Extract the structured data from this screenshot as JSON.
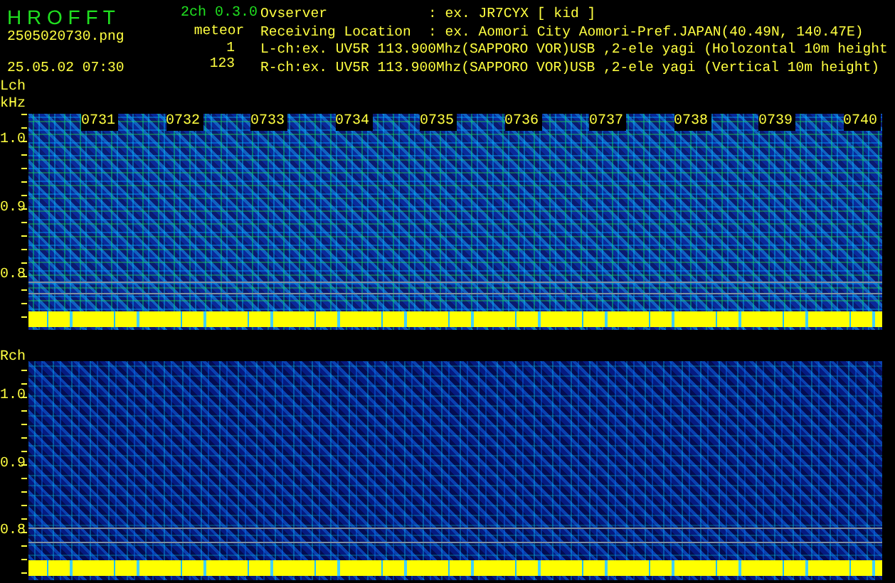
{
  "header": {
    "app_title": "H R O F F T",
    "version": "2ch 0.3.0",
    "filename": "2505020730.png",
    "datetime": "25.05.02 07:30",
    "meteor_label": "meteor",
    "meteor_counts": [
      "1",
      "123"
    ],
    "info_lines": [
      {
        "label": "Ovserver",
        "value": ": ex. JR7CYX [ kid ]"
      },
      {
        "label": "Receiving Location",
        "value": ": ex. Aomori City Aomori-Pref.JAPAN(40.49N, 140.47E)"
      },
      {
        "text": "L-ch:ex. UV5R 113.900Mhz(SAPPORO VOR)USB ,2-ele yagi (Holozontal 10m height"
      },
      {
        "text": "R-ch:ex. UV5R 113.900Mhz(SAPPORO VOR)USB ,2-ele yagi (Vertical 10m height)"
      }
    ]
  },
  "channels": [
    {
      "name": "Lch",
      "unit": "kHz",
      "y_ticks": [
        "1.0",
        "0.9",
        "0.8"
      ],
      "time_labels": [
        "0731",
        "0732",
        "0733",
        "0734",
        "0735",
        "0736",
        "0737",
        "0738",
        "0739",
        "0740"
      ]
    },
    {
      "name": "Rch",
      "y_ticks": [
        "1.0",
        "0.9",
        "0.8"
      ]
    }
  ]
}
